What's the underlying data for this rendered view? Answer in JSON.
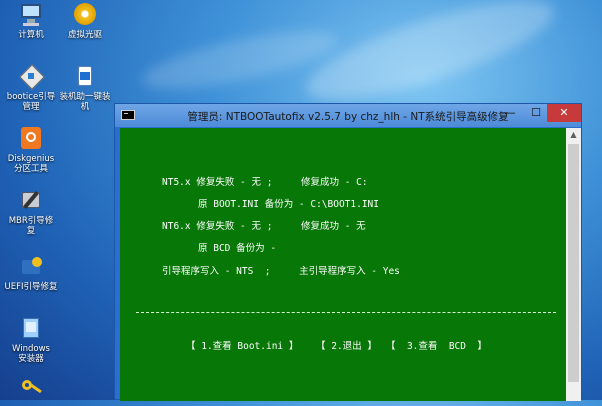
{
  "desktop": {
    "icons": [
      {
        "name": "computer",
        "label": "计算机"
      },
      {
        "name": "virtual-drive",
        "label": "虚拟光驱"
      },
      {
        "name": "bootice",
        "label": "bootice引导\n管理"
      },
      {
        "name": "installer",
        "label": "装机助一键装\n机"
      },
      {
        "name": "diskgenius",
        "label": "Diskgenius\n分区工具"
      },
      {
        "name": "mbr-repair",
        "label": "MBR引导修\n复"
      },
      {
        "name": "uefi-repair",
        "label": "UEFI引导修复"
      },
      {
        "name": "windows-installer",
        "label": "Windows\n安装器"
      }
    ]
  },
  "window": {
    "title": "管理员:  NTBOOTautofix v2.5.7 by chz_hlh - NT系统引导高级修复",
    "min_label": "—",
    "max_label": "☐",
    "close_label": "✕"
  },
  "console": {
    "lines": [
      "NT5.x 修复失败 - 无 ;     修复成功 - C:",
      "原 BOOT.INI 备份为 - C:\\BOOT1.INI",
      "NT6.x 修复失败 - 无 ;     修复成功 - 无",
      "原 BCD 备份为 -",
      "引导程序写入 - NTS  ;     主引导程序写入 - Yes"
    ],
    "menu": [
      "【 1.查看 Boot.ini 】",
      "【 2.退出 】",
      "【  3.查看  BCD  】"
    ]
  },
  "colors": {
    "console_bg": "#077707",
    "title_bar": "#5b96de",
    "close_button": "#c7393a"
  }
}
